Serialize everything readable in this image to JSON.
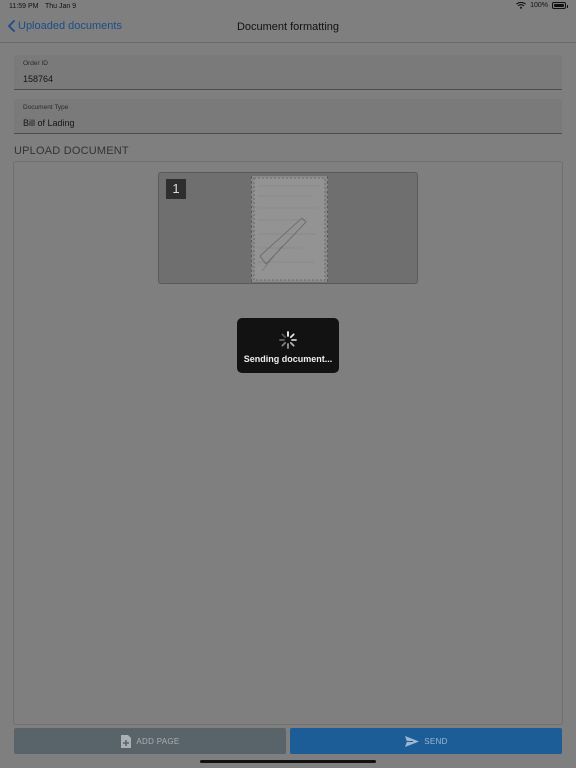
{
  "status": {
    "time": "11:59 PM",
    "date": "Thu Jan 9",
    "battery": "100%"
  },
  "nav": {
    "back_label": "Uploaded documents",
    "title": "Document formatting"
  },
  "fields": {
    "order_id": {
      "label": "Order ID",
      "value": "158764"
    },
    "document_type": {
      "label": "Document Type",
      "value": "Bill of Lading"
    }
  },
  "upload": {
    "section_title": "UPLOAD DOCUMENT",
    "pages": [
      {
        "number": "1"
      }
    ]
  },
  "toast": {
    "message": "Sending document..."
  },
  "buttons": {
    "add_page": "ADD PAGE",
    "send": "SEND"
  },
  "icons": {
    "back": "chevron-left-icon",
    "wifi": "wifi-icon",
    "battery": "battery-icon",
    "spinner": "spinner-icon",
    "add_page": "add-file-icon",
    "send": "paper-plane-icon"
  },
  "colors": {
    "link": "#1b4d86",
    "send_button": "#1c5d98",
    "add_button": "#59636a",
    "toast": "#121212"
  }
}
